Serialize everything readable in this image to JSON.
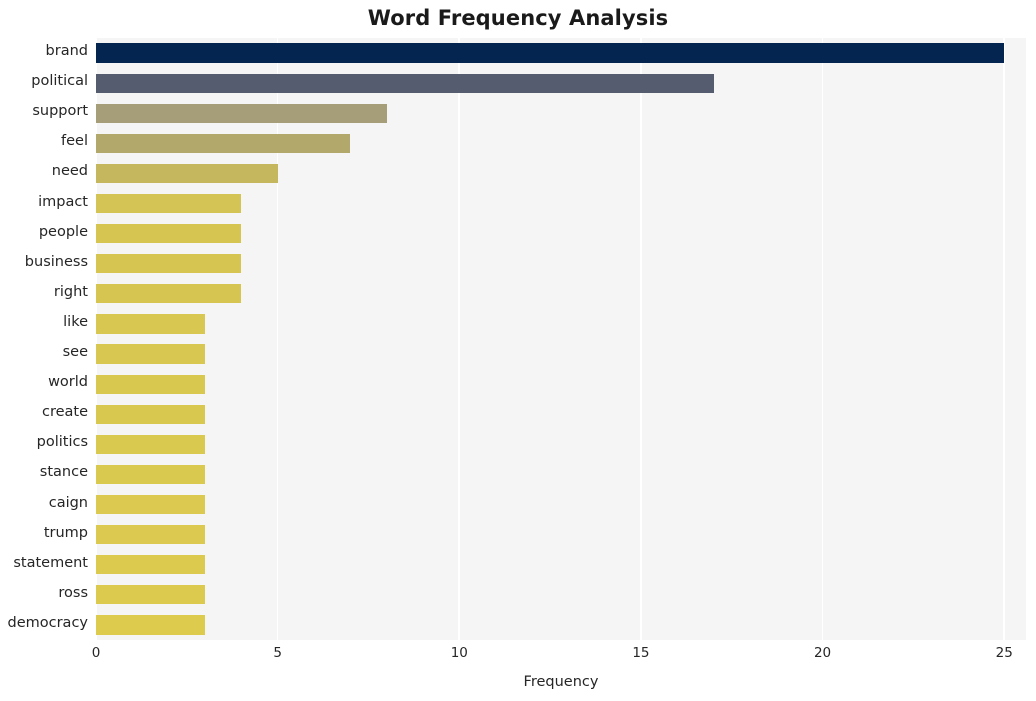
{
  "chart_data": {
    "type": "bar",
    "orientation": "horizontal",
    "title": "Word Frequency Analysis",
    "xlabel": "Frequency",
    "ylabel": "",
    "xlim": [
      0,
      25.6
    ],
    "xticks": [
      0,
      5,
      10,
      15,
      20,
      25
    ],
    "xtick_labels": [
      "0",
      "5",
      "10",
      "15",
      "20",
      "25"
    ],
    "grid": "vertical-only",
    "legend": "none",
    "plot_background": "#f5f5f5",
    "gridline_color": "#ffffff",
    "categories": [
      "brand",
      "political",
      "support",
      "feel",
      "need",
      "impact",
      "people",
      "business",
      "right",
      "like",
      "see",
      "world",
      "create",
      "politics",
      "stance",
      "caign",
      "trump",
      "statement",
      "ross",
      "democracy"
    ],
    "values": [
      25,
      17,
      8,
      7,
      5,
      4,
      4,
      4,
      4,
      3,
      3,
      3,
      3,
      3,
      3,
      3,
      3,
      3,
      3,
      3
    ],
    "bar_colors": [
      "#042550",
      "#565c70",
      "#a69e79",
      "#b2a86c",
      "#c4b75e",
      "#d4c455",
      "#d6c551",
      "#d6c551",
      "#d6c551",
      "#d8c750",
      "#d8c750",
      "#d9c84f",
      "#d9c84f",
      "#dac94f",
      "#dac94f",
      "#dbca4f",
      "#dbca4f",
      "#dcca4e",
      "#dcca4e",
      "#ddcb4e"
    ]
  }
}
